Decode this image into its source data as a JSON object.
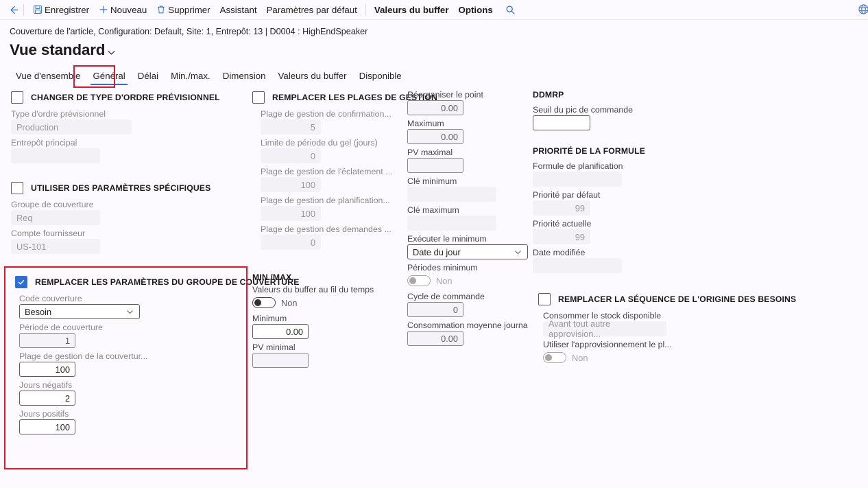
{
  "toolbar": {
    "back_label": "back-arrow",
    "items": [
      {
        "label": "Enregistrer",
        "icon": "save-icon"
      },
      {
        "label": "Nouveau",
        "icon": "plus-icon"
      },
      {
        "label": "Supprimer",
        "icon": "trash-icon"
      },
      {
        "label": "Assistant",
        "icon": ""
      },
      {
        "label": "Paramètres par défaut",
        "icon": ""
      },
      {
        "label": "Valeurs du buffer",
        "icon": ""
      },
      {
        "label": "Options",
        "icon": ""
      }
    ],
    "search_icon": "search-icon",
    "right_icon": "globe-icon"
  },
  "caption": "Couverture de l'article, Configuration: Default, Site: 1, Entrepôt: 13  |  D0004 : HighEndSpeaker",
  "header": {
    "title": "Vue standard",
    "chevron": "chevron-down-icon"
  },
  "tabs": [
    {
      "label": "Vue d'ensemble",
      "active": false
    },
    {
      "label": "Général",
      "active": true
    },
    {
      "label": "Délai",
      "active": false
    },
    {
      "label": "Min./max.",
      "active": false
    },
    {
      "label": "Dimension",
      "active": false
    },
    {
      "label": "Valeurs du buffer",
      "active": false
    },
    {
      "label": "Disponible",
      "active": false
    }
  ],
  "colors": {
    "accent": "#2c6ed5",
    "highlight": "#e8142b",
    "background": "#fdfaff"
  },
  "column1": {
    "group_forecast": {
      "title": "CHANGER DE TYPE D'ORDRE PRÉVISIONNEL",
      "checked": false,
      "fields": [
        {
          "label": "Type d'ordre prévisionnel",
          "value": "Production"
        },
        {
          "label": "Entrepôt principal",
          "value": ""
        }
      ]
    },
    "group_specific": {
      "title": "UTILISER DES PARAMÈTRES SPÉCIFIQUES",
      "checked": false,
      "fields": [
        {
          "label": "Groupe de couverture",
          "value": "Req"
        },
        {
          "label": "Compte fournisseur",
          "value": "US-101"
        }
      ]
    },
    "group_override": {
      "title": "REMPLACER LES PARAMÈTRES DU GROUPE DE COUVERTURE",
      "checked": true,
      "code_label": "Code couverture",
      "code_value": "Besoin",
      "fields": [
        {
          "label": "Période de couverture",
          "value": "1"
        },
        {
          "label": "Plage de gestion de la couvertur...",
          "value": "100"
        },
        {
          "label": "Jours négatifs",
          "value": "2"
        },
        {
          "label": "Jours positifs",
          "value": "100"
        }
      ]
    }
  },
  "column2": {
    "group_ranges": {
      "title": "REMPLACER LES PLAGES DE GESTION",
      "checked": false,
      "fields": [
        {
          "label": "Plage de gestion de confirmation...",
          "value": "5"
        },
        {
          "label": "Limite de période du gel (jours)",
          "value": "0"
        },
        {
          "label": "Plage de gestion de l'éclatement ...",
          "value": "100"
        },
        {
          "label": "Plage de gestion de planification...",
          "value": "100"
        },
        {
          "label": "Plage de gestion des demandes ...",
          "value": "0"
        }
      ]
    },
    "minmax": {
      "title": "MIN./MAX.",
      "toggle_label": "Valeurs du buffer au fil du temps",
      "toggle_value": "Non",
      "fields": [
        {
          "label": "Minimum",
          "value": "0.00"
        },
        {
          "label": "PV minimal",
          "value": ""
        }
      ]
    }
  },
  "column3": {
    "fields": [
      {
        "label": "Réorganiser le point",
        "value": "0.00"
      },
      {
        "label": "Maximum",
        "value": "0.00"
      },
      {
        "label": "PV maximal",
        "value": ""
      },
      {
        "label": "Clé minimum",
        "value": ""
      },
      {
        "label": "Clé maximum",
        "value": ""
      }
    ],
    "execute_min": {
      "label": "Exécuter le minimum",
      "value": "Date du jour",
      "chevron": "chevron-down-icon"
    },
    "periods_min": {
      "label": "Périodes minimum",
      "value": "Non"
    },
    "after_fields": [
      {
        "label": "Cycle de commande",
        "value": "0"
      },
      {
        "label": "Consommation moyenne journal...",
        "value": "0.00"
      }
    ]
  },
  "column4": {
    "ddmrp": {
      "title": "DDMRP",
      "fields": [
        {
          "label": "Seuil du pic de commande",
          "value": ""
        }
      ]
    },
    "priority": {
      "title": "PRIORITÉ DE LA FORMULE",
      "fields": [
        {
          "label": "Formule de planification",
          "value": ""
        },
        {
          "label": "Priorité par défaut",
          "value": "99"
        },
        {
          "label": "Priorité actuelle",
          "value": "99"
        },
        {
          "label": "Date modifiée",
          "value": ""
        }
      ]
    },
    "group_sequence": {
      "title": "REMPLACER LA SÉQUENCE DE L'ORIGINE DES BESOINS",
      "checked": false,
      "consume_label": "Consommer le stock disponible",
      "consume_value": "Avant tout autre approvision...",
      "supply_label": "Utiliser l'approvisionnement le pl...",
      "supply_value": "Non"
    }
  }
}
